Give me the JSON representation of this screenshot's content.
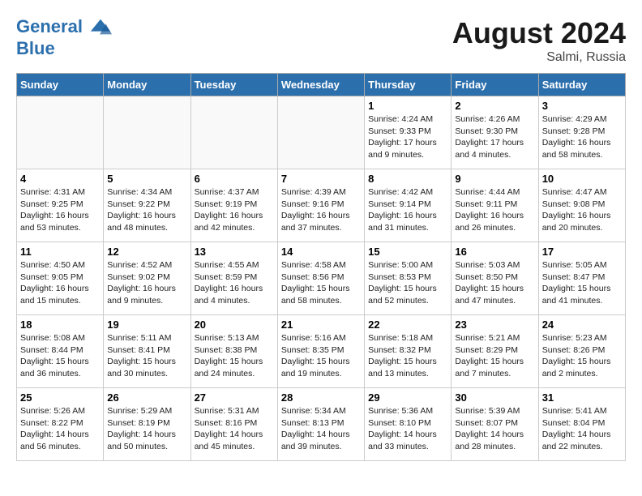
{
  "header": {
    "logo_line1": "General",
    "logo_line2": "Blue",
    "month_year": "August 2024",
    "location": "Salmi, Russia"
  },
  "weekdays": [
    "Sunday",
    "Monday",
    "Tuesday",
    "Wednesday",
    "Thursday",
    "Friday",
    "Saturday"
  ],
  "weeks": [
    [
      {
        "day": "",
        "content": ""
      },
      {
        "day": "",
        "content": ""
      },
      {
        "day": "",
        "content": ""
      },
      {
        "day": "",
        "content": ""
      },
      {
        "day": "1",
        "content": "Sunrise: 4:24 AM\nSunset: 9:33 PM\nDaylight: 17 hours\nand 9 minutes."
      },
      {
        "day": "2",
        "content": "Sunrise: 4:26 AM\nSunset: 9:30 PM\nDaylight: 17 hours\nand 4 minutes."
      },
      {
        "day": "3",
        "content": "Sunrise: 4:29 AM\nSunset: 9:28 PM\nDaylight: 16 hours\nand 58 minutes."
      }
    ],
    [
      {
        "day": "4",
        "content": "Sunrise: 4:31 AM\nSunset: 9:25 PM\nDaylight: 16 hours\nand 53 minutes."
      },
      {
        "day": "5",
        "content": "Sunrise: 4:34 AM\nSunset: 9:22 PM\nDaylight: 16 hours\nand 48 minutes."
      },
      {
        "day": "6",
        "content": "Sunrise: 4:37 AM\nSunset: 9:19 PM\nDaylight: 16 hours\nand 42 minutes."
      },
      {
        "day": "7",
        "content": "Sunrise: 4:39 AM\nSunset: 9:16 PM\nDaylight: 16 hours\nand 37 minutes."
      },
      {
        "day": "8",
        "content": "Sunrise: 4:42 AM\nSunset: 9:14 PM\nDaylight: 16 hours\nand 31 minutes."
      },
      {
        "day": "9",
        "content": "Sunrise: 4:44 AM\nSunset: 9:11 PM\nDaylight: 16 hours\nand 26 minutes."
      },
      {
        "day": "10",
        "content": "Sunrise: 4:47 AM\nSunset: 9:08 PM\nDaylight: 16 hours\nand 20 minutes."
      }
    ],
    [
      {
        "day": "11",
        "content": "Sunrise: 4:50 AM\nSunset: 9:05 PM\nDaylight: 16 hours\nand 15 minutes."
      },
      {
        "day": "12",
        "content": "Sunrise: 4:52 AM\nSunset: 9:02 PM\nDaylight: 16 hours\nand 9 minutes."
      },
      {
        "day": "13",
        "content": "Sunrise: 4:55 AM\nSunset: 8:59 PM\nDaylight: 16 hours\nand 4 minutes."
      },
      {
        "day": "14",
        "content": "Sunrise: 4:58 AM\nSunset: 8:56 PM\nDaylight: 15 hours\nand 58 minutes."
      },
      {
        "day": "15",
        "content": "Sunrise: 5:00 AM\nSunset: 8:53 PM\nDaylight: 15 hours\nand 52 minutes."
      },
      {
        "day": "16",
        "content": "Sunrise: 5:03 AM\nSunset: 8:50 PM\nDaylight: 15 hours\nand 47 minutes."
      },
      {
        "day": "17",
        "content": "Sunrise: 5:05 AM\nSunset: 8:47 PM\nDaylight: 15 hours\nand 41 minutes."
      }
    ],
    [
      {
        "day": "18",
        "content": "Sunrise: 5:08 AM\nSunset: 8:44 PM\nDaylight: 15 hours\nand 36 minutes."
      },
      {
        "day": "19",
        "content": "Sunrise: 5:11 AM\nSunset: 8:41 PM\nDaylight: 15 hours\nand 30 minutes."
      },
      {
        "day": "20",
        "content": "Sunrise: 5:13 AM\nSunset: 8:38 PM\nDaylight: 15 hours\nand 24 minutes."
      },
      {
        "day": "21",
        "content": "Sunrise: 5:16 AM\nSunset: 8:35 PM\nDaylight: 15 hours\nand 19 minutes."
      },
      {
        "day": "22",
        "content": "Sunrise: 5:18 AM\nSunset: 8:32 PM\nDaylight: 15 hours\nand 13 minutes."
      },
      {
        "day": "23",
        "content": "Sunrise: 5:21 AM\nSunset: 8:29 PM\nDaylight: 15 hours\nand 7 minutes."
      },
      {
        "day": "24",
        "content": "Sunrise: 5:23 AM\nSunset: 8:26 PM\nDaylight: 15 hours\nand 2 minutes."
      }
    ],
    [
      {
        "day": "25",
        "content": "Sunrise: 5:26 AM\nSunset: 8:22 PM\nDaylight: 14 hours\nand 56 minutes."
      },
      {
        "day": "26",
        "content": "Sunrise: 5:29 AM\nSunset: 8:19 PM\nDaylight: 14 hours\nand 50 minutes."
      },
      {
        "day": "27",
        "content": "Sunrise: 5:31 AM\nSunset: 8:16 PM\nDaylight: 14 hours\nand 45 minutes."
      },
      {
        "day": "28",
        "content": "Sunrise: 5:34 AM\nSunset: 8:13 PM\nDaylight: 14 hours\nand 39 minutes."
      },
      {
        "day": "29",
        "content": "Sunrise: 5:36 AM\nSunset: 8:10 PM\nDaylight: 14 hours\nand 33 minutes."
      },
      {
        "day": "30",
        "content": "Sunrise: 5:39 AM\nSunset: 8:07 PM\nDaylight: 14 hours\nand 28 minutes."
      },
      {
        "day": "31",
        "content": "Sunrise: 5:41 AM\nSunset: 8:04 PM\nDaylight: 14 hours\nand 22 minutes."
      }
    ]
  ]
}
